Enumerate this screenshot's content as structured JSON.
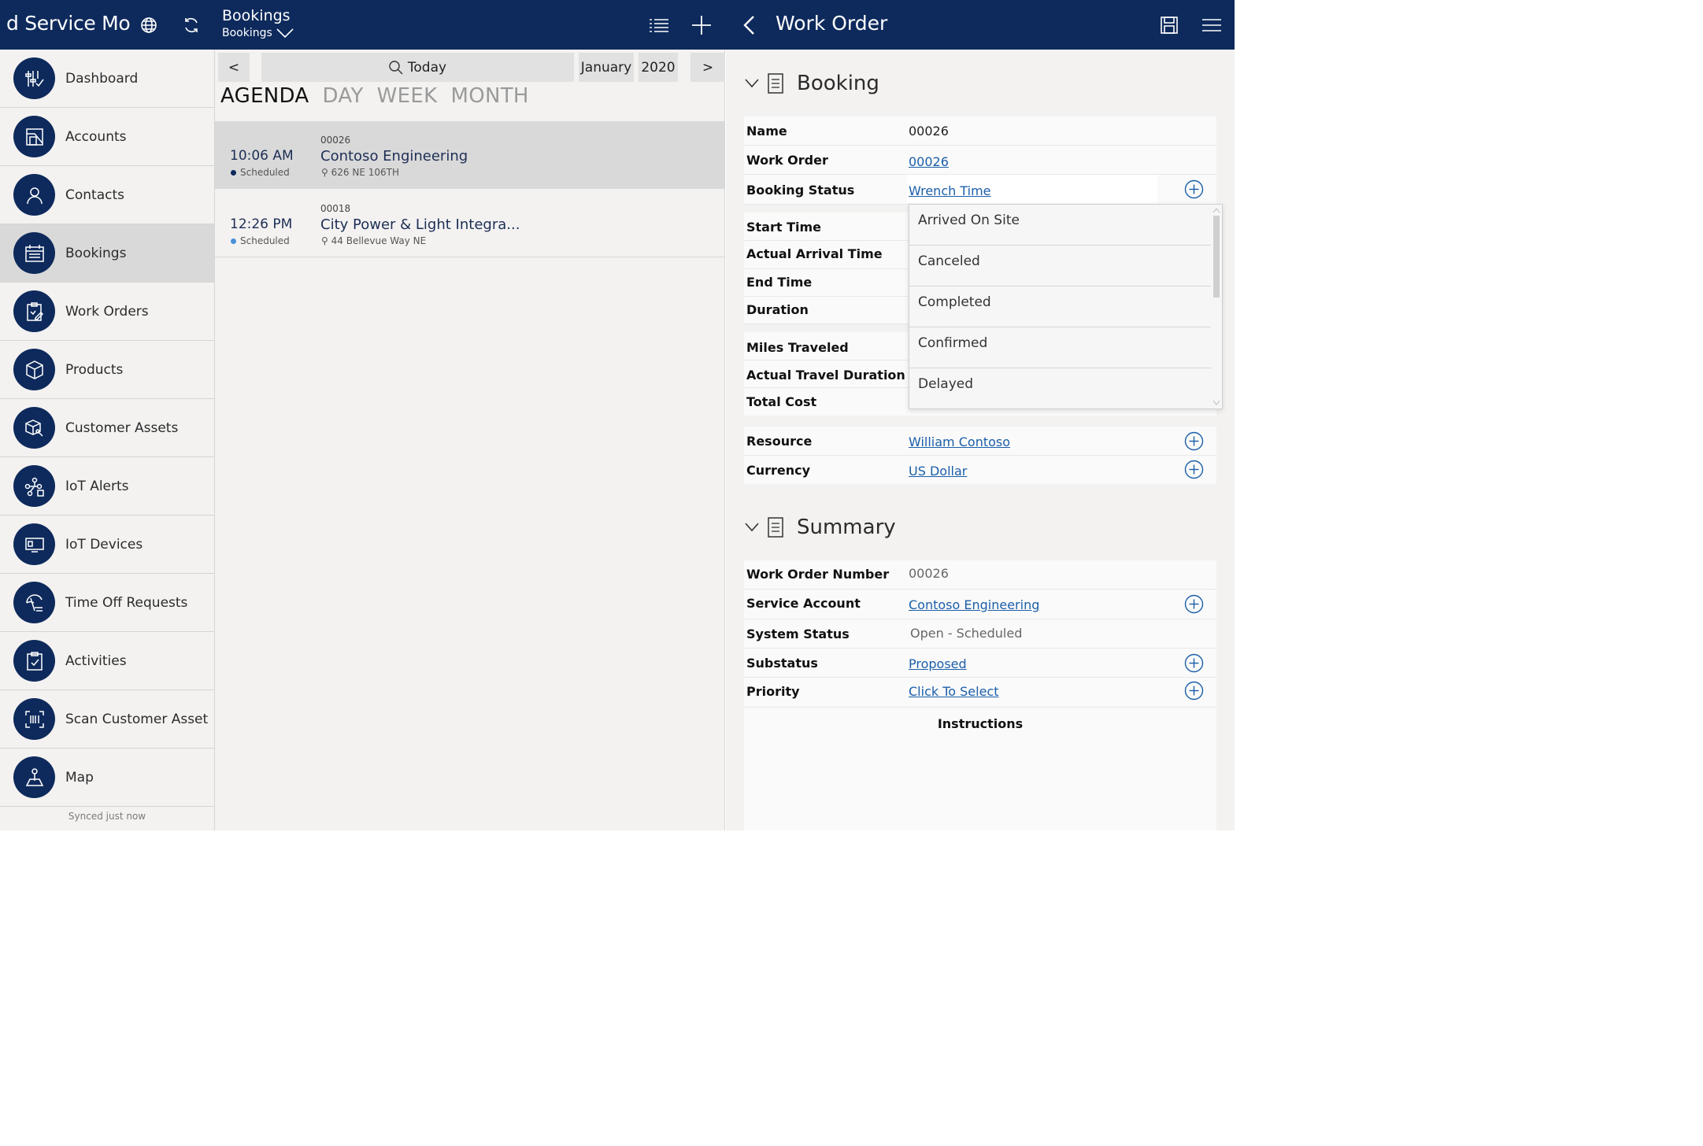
{
  "header": {
    "app_title": "d Service Mo",
    "crumb_title": "Bookings",
    "crumb_sub": "Bookings",
    "work_order_title": "Work Order"
  },
  "sidebar": {
    "items": [
      {
        "label": "Dashboard",
        "icon": "dashboard-icon"
      },
      {
        "label": "Accounts",
        "icon": "accounts-icon"
      },
      {
        "label": "Contacts",
        "icon": "contacts-icon"
      },
      {
        "label": "Bookings",
        "icon": "bookings-icon"
      },
      {
        "label": "Work Orders",
        "icon": "work-orders-icon"
      },
      {
        "label": "Products",
        "icon": "products-icon"
      },
      {
        "label": "Customer Assets",
        "icon": "customer-assets-icon"
      },
      {
        "label": "IoT Alerts",
        "icon": "iot-alerts-icon"
      },
      {
        "label": "IoT Devices",
        "icon": "iot-devices-icon"
      },
      {
        "label": "Time Off Requests",
        "icon": "time-off-icon"
      },
      {
        "label": "Activities",
        "icon": "activities-icon"
      },
      {
        "label": "Scan Customer Asset",
        "icon": "scan-icon"
      },
      {
        "label": "Map",
        "icon": "map-icon"
      }
    ],
    "active_index": 3,
    "sync_status": "Synced just now"
  },
  "calendar": {
    "prev": "<",
    "next": ">",
    "today": "Today",
    "month": "January",
    "year": "2020",
    "views": [
      "AGENDA",
      "DAY",
      "WEEK",
      "MONTH"
    ],
    "active_view": "AGENDA"
  },
  "agenda": [
    {
      "time": "10:06 AM",
      "status": "Scheduled",
      "number": "00026",
      "name": "Contoso Engineering",
      "address": "626 NE 106TH",
      "selected": true,
      "dot_color": "#0e2a5c"
    },
    {
      "time": "12:26 PM",
      "status": "Scheduled",
      "number": "00018",
      "name": "City Power & Light Integra...",
      "address": "44 Bellevue Way NE",
      "selected": false,
      "dot_color": "#4a90d9"
    }
  ],
  "booking": {
    "section_title": "Booking",
    "fields": {
      "name": {
        "label": "Name",
        "value": "00026"
      },
      "work_order": {
        "label": "Work Order",
        "value": "00026"
      },
      "booking_status": {
        "label": "Booking Status",
        "value": "Wrench Time"
      },
      "start_time": {
        "label": "Start Time"
      },
      "actual_arrival": {
        "label": "Actual Arrival Time"
      },
      "end_time": {
        "label": "End Time"
      },
      "duration": {
        "label": "Duration"
      },
      "miles": {
        "label": "Miles Traveled"
      },
      "travel_duration": {
        "label": "Actual Travel Duration"
      },
      "total_cost": {
        "label": "Total Cost"
      },
      "resource": {
        "label": "Resource",
        "value": "William Contoso"
      },
      "currency": {
        "label": "Currency",
        "value": "US Dollar"
      }
    },
    "status_options": [
      "Arrived On Site",
      "Canceled",
      "Completed",
      "Confirmed",
      "Delayed"
    ]
  },
  "summary": {
    "section_title": "Summary",
    "fields": {
      "wo_number": {
        "label": "Work Order Number",
        "value": "00026"
      },
      "service_account": {
        "label": "Service Account",
        "value": "Contoso Engineering"
      },
      "system_status": {
        "label": "System Status",
        "value": "Open - Scheduled"
      },
      "substatus": {
        "label": "Substatus",
        "value": "Proposed"
      },
      "priority": {
        "label": "Priority",
        "value": "Click To Select"
      }
    },
    "instructions_label": "Instructions"
  },
  "colors": {
    "navy": "#0e2a5c",
    "link": "#1b5ea9",
    "panel": "#f3f2f1"
  }
}
